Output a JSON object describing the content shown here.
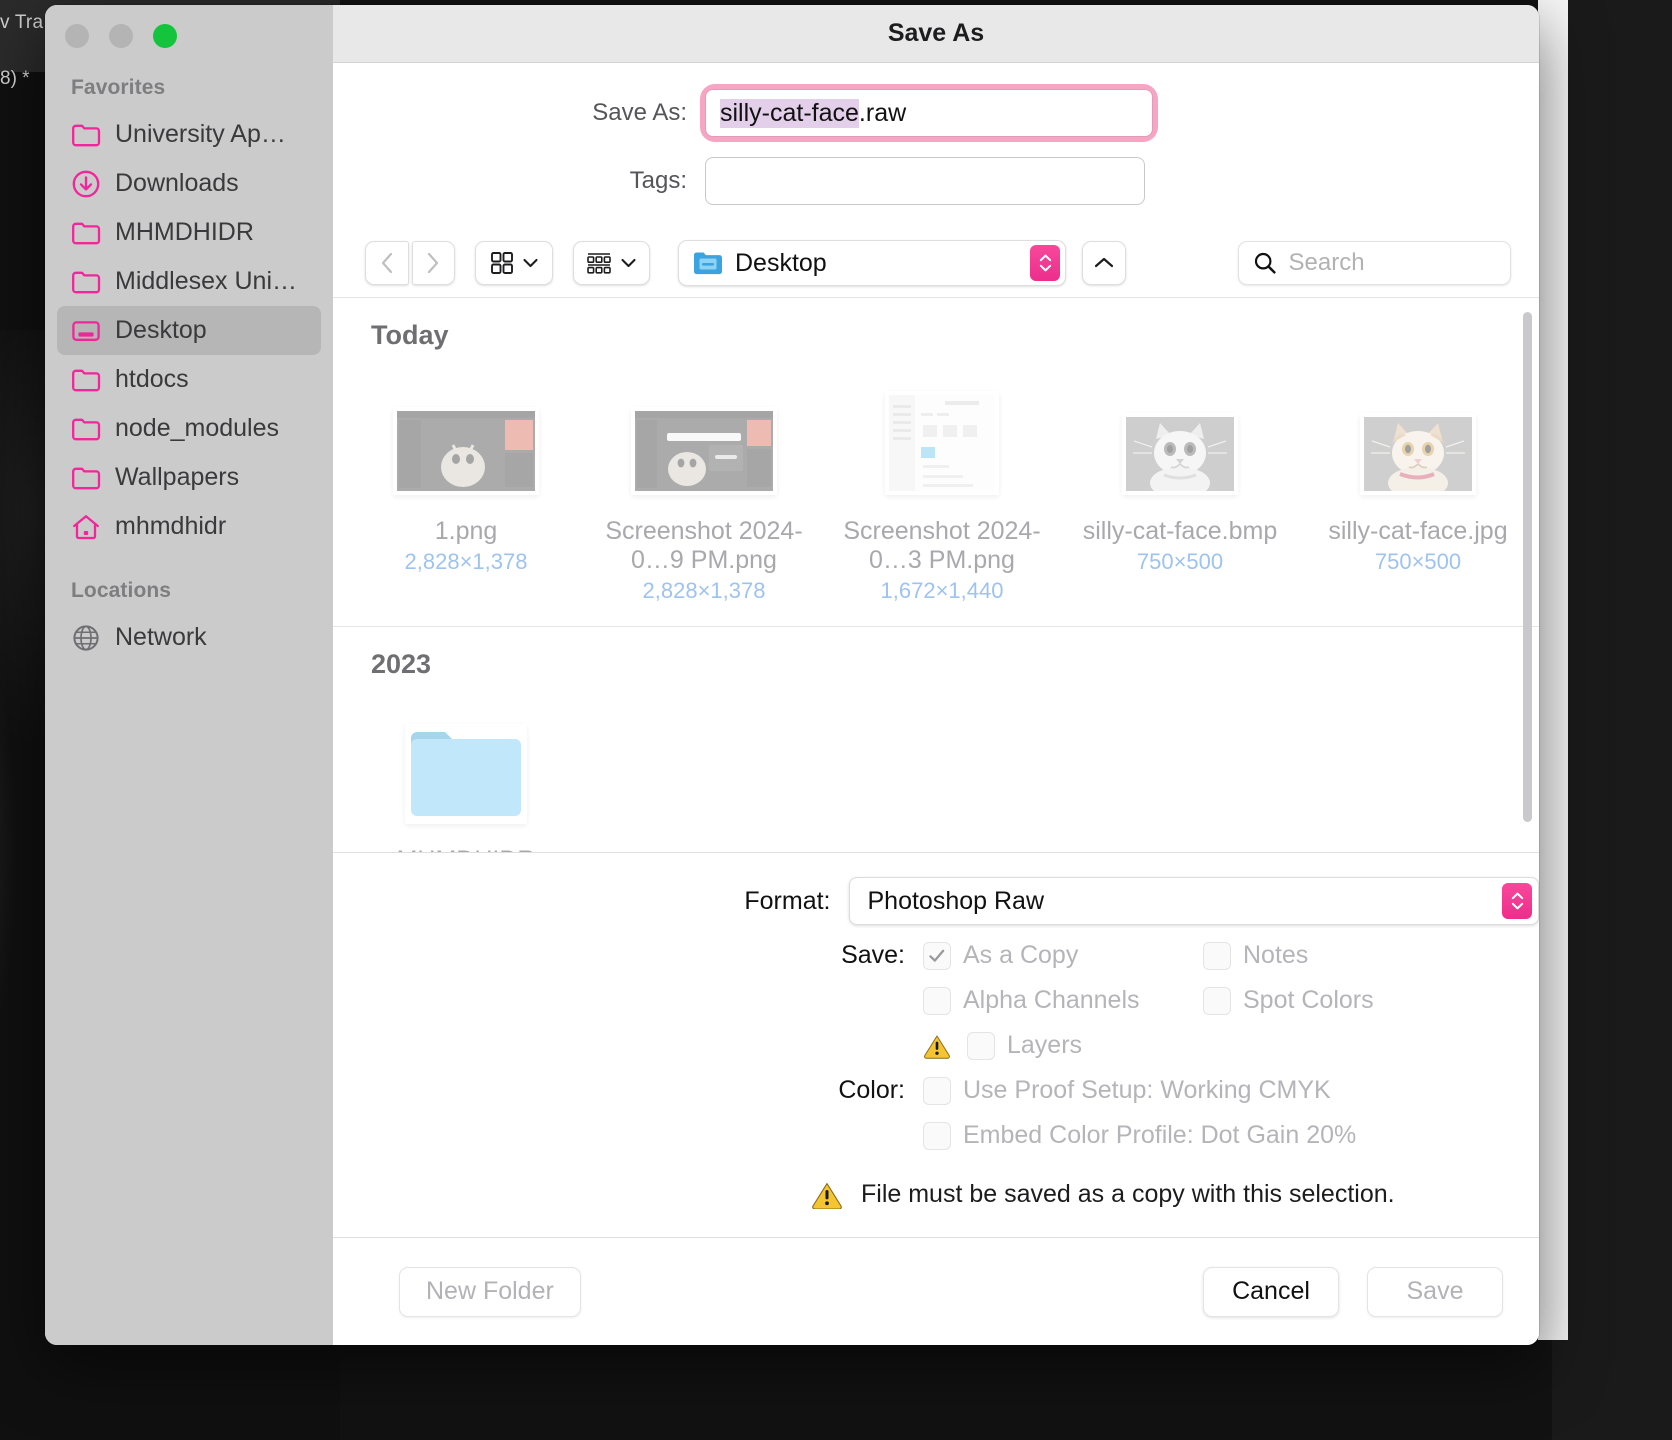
{
  "window": {
    "title": "Save As",
    "traffic_lights": [
      "close",
      "minimize",
      "zoom"
    ]
  },
  "form": {
    "save_as_label": "Save As:",
    "filename_selected": "silly-cat-face",
    "filename_extension": ".raw",
    "tags_label": "Tags:",
    "tags_value": "",
    "tags_placeholder": ""
  },
  "toolbar": {
    "back": "back-icon",
    "forward": "forward-icon",
    "icon_view": "grid-view-icon",
    "group_view": "group-view-icon",
    "path_label": "Desktop",
    "up_label": "up-icon",
    "search_placeholder": "Search"
  },
  "sidebar": {
    "sections": [
      {
        "title": "Favorites",
        "items": [
          {
            "label": "University Ap…",
            "icon": "folder-icon",
            "selected": false
          },
          {
            "label": "Downloads",
            "icon": "downloads-icon",
            "selected": false
          },
          {
            "label": "MHMDHIDR",
            "icon": "folder-icon",
            "selected": false
          },
          {
            "label": "Middlesex Uni…",
            "icon": "folder-icon",
            "selected": false
          },
          {
            "label": "Desktop",
            "icon": "desktop-icon",
            "selected": true
          },
          {
            "label": "htdocs",
            "icon": "folder-icon",
            "selected": false
          },
          {
            "label": "node_modules",
            "icon": "folder-icon",
            "selected": false
          },
          {
            "label": "Wallpapers",
            "icon": "folder-icon",
            "selected": false
          },
          {
            "label": "mhmdhidr",
            "icon": "home-icon",
            "selected": false
          }
        ]
      },
      {
        "title": "Locations",
        "items": [
          {
            "label": "Network",
            "icon": "globe-icon",
            "selected": false
          }
        ]
      }
    ]
  },
  "browser": {
    "groups": [
      {
        "title": "Today",
        "files": [
          {
            "name": "1.png",
            "dimensions": "2,828×1,378",
            "thumb": "screenshot-dark"
          },
          {
            "name": "Screenshot 2024-0…9 PM.png",
            "dimensions": "2,828×1,378",
            "thumb": "screenshot-dark-dialog"
          },
          {
            "name": "Screenshot 2024-0…3 PM.png",
            "dimensions": "1,672×1,440",
            "thumb": "screenshot-light"
          },
          {
            "name": "silly-cat-face.bmp",
            "dimensions": "750×500",
            "thumb": "cat-gray"
          },
          {
            "name": "silly-cat-face.jpg",
            "dimensions": "750×500",
            "thumb": "cat-color"
          }
        ]
      },
      {
        "title": "2023",
        "files": [
          {
            "name": "MHMDHIDR",
            "dimensions": "",
            "thumb": "folder"
          }
        ]
      }
    ]
  },
  "options": {
    "format_label": "Format:",
    "format_value": "Photoshop Raw",
    "save_label": "Save:",
    "color_label": "Color:",
    "checkboxes": [
      {
        "label": "As a Copy",
        "checked": true,
        "disabled": true,
        "warning": false
      },
      {
        "label": "Notes",
        "checked": false,
        "disabled": true,
        "warning": false
      },
      {
        "label": "Alpha Channels",
        "checked": false,
        "disabled": true,
        "warning": false
      },
      {
        "label": "Spot Colors",
        "checked": false,
        "disabled": true,
        "warning": false
      },
      {
        "label": "Layers",
        "checked": false,
        "disabled": true,
        "warning": true
      },
      {
        "label": "Use Proof Setup:  Working CMYK",
        "checked": false,
        "disabled": true,
        "warning": false
      },
      {
        "label": "Embed Color Profile:  Dot Gain 20%",
        "checked": false,
        "disabled": true,
        "warning": false
      }
    ],
    "warning_message": "File must be saved as a copy with this selection."
  },
  "footer": {
    "new_folder_label": "New Folder",
    "cancel_label": "Cancel",
    "save_label": "Save"
  },
  "backdrop": {
    "text_left_top": "v Tra",
    "text_left_bottom": "8) *"
  },
  "colors": {
    "accent_pink": "#ec2e8c",
    "folder_pink": "#f0269a",
    "folder_blue": "#62c3f2",
    "warning_yellow": "#f2c231",
    "dimension_blue": "#9fc3ef",
    "selection_purple": "#e3cfea",
    "focus_ring_pink": "#f6a5c3"
  }
}
